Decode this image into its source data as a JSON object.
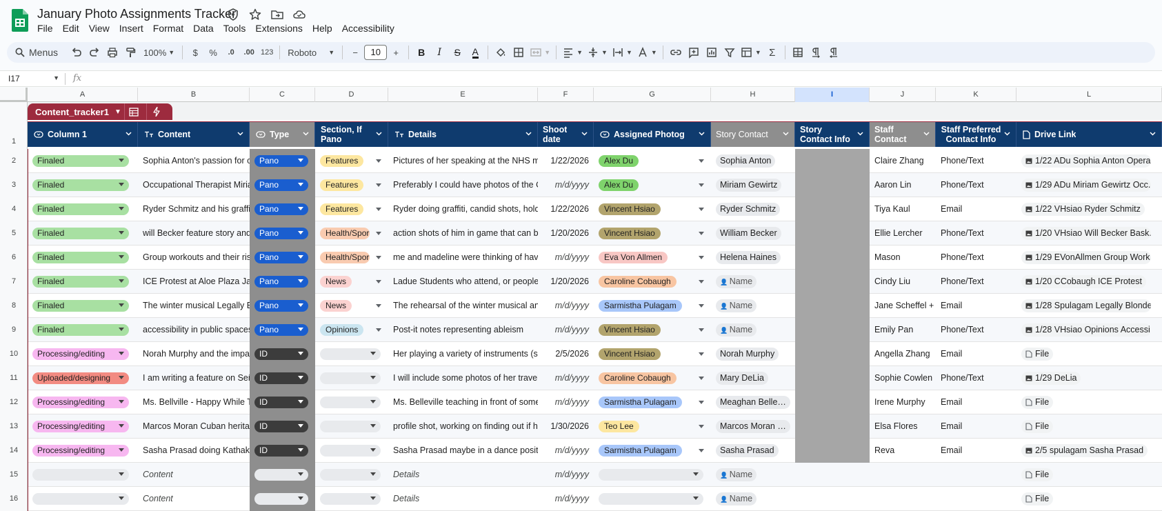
{
  "app": {
    "title": "January Photo Assignments Tracker",
    "menus": [
      "File",
      "Edit",
      "View",
      "Insert",
      "Format",
      "Data",
      "Tools",
      "Extensions",
      "Help",
      "Accessibility"
    ],
    "brand_color": "#0f9d58"
  },
  "toolbar": {
    "search_label": "Menus",
    "zoom": "100%",
    "currency": "$",
    "percent": "%",
    "decrease_decimal": ".0",
    "increase_decimal": ".00",
    "number_format": "123",
    "font": "Roboto",
    "font_size": "10",
    "minus": "−",
    "plus": "+",
    "bold": "B",
    "italic": "I",
    "strike": "S",
    "text_color": "A",
    "sum": "Σ"
  },
  "formula_bar": {
    "name_box": "I17",
    "fx": "fx",
    "value": ""
  },
  "columns": [
    "A",
    "B",
    "C",
    "D",
    "E",
    "F",
    "G",
    "H",
    "I",
    "J",
    "K",
    "L"
  ],
  "selected_column": "I",
  "row_numbers": [
    "1",
    "2",
    "3",
    "4",
    "5",
    "6",
    "7",
    "8",
    "9",
    "10",
    "11",
    "12",
    "13",
    "14",
    "15",
    "16"
  ],
  "table": {
    "name": "Content_tracker1",
    "header_color": "#0f3b6e",
    "tab_color": "#9d2b3e",
    "headers": {
      "a": "Column 1",
      "b": "Content",
      "c": "Type",
      "d1": "Section, If",
      "d2": "Pano",
      "e": "Details",
      "f1": "Shoot",
      "f2": "date",
      "g": "Assigned Photog",
      "h": "Story Contact",
      "i1": "Story",
      "i2": "Contact Info",
      "j1": "Staff",
      "j2": "Contact",
      "k1": "Staff Preferred",
      "k2": "Contact Info",
      "l": "Drive Link"
    },
    "status_colors": {
      "Finaled": "#a8e0a2",
      "Processing/editing": "#f7b7f0",
      "Uploaded/designing": "#f28b82"
    },
    "type_colors": {
      "Pano": "#1a5ecf",
      "ID": "#3c3c3c"
    },
    "section_colors": {
      "Features": "#fde7a0",
      "Health/Sport": "#f9cbb0",
      "News": "#fbd2d0",
      "Opinions": "#cbe5f0"
    },
    "photog_colors": {
      "Alex Du": "#7fd36c",
      "Vincent Hsiao": "#b2a46d",
      "Eva Von Allmen": "#f8c7c4",
      "Caroline Cobaugh": "#f8c5a2",
      "Sarmistha Pulagam": "#a8c7fa",
      "Teo Lee": "#fde7a0"
    },
    "rows": [
      {
        "status": "Finaled",
        "content": "Sophia Anton's passion for co",
        "type": "Pano",
        "section": "Features",
        "details": "Pictures of her speaking at the NHS me",
        "date": "1/22/2026",
        "photog": "Alex Du",
        "story_contact": "Sophia Anton",
        "staff": "Claire Zhang",
        "pref": "Phone/Text",
        "drive": "1/22 ADu Sophia Anton Opera..."
      },
      {
        "status": "Finaled",
        "content": "Occupational Therapist Miriam",
        "type": "Pano",
        "section": "Features",
        "details": "Preferably I could have photos of the OT",
        "date": "m/d/yyyy",
        "photog": "Alex Du",
        "story_contact": "Miriam Gewirtz",
        "staff": "Aaron Lin",
        "pref": "Phone/Text",
        "drive": "1/29 ADu Miriam Gewirtz Occ..."
      },
      {
        "status": "Finaled",
        "content": "Ryder Schmitz and his graffiti",
        "type": "Pano",
        "section": "Features",
        "details": "Ryder doing graffiti, candid shots, holdin",
        "date": "1/22/2026",
        "photog": "Vincent Hsiao",
        "story_contact": "Ryder Schmitz",
        "staff": "Tiya Kaul",
        "pref": "Email",
        "drive": "1/22 VHsiao Ryder Schmitz"
      },
      {
        "status": "Finaled",
        "content": "will Becker feature story and I",
        "type": "Pano",
        "section": "Health/Sport",
        "details": "action shots of him in game that can be",
        "date": "1/20/2026",
        "photog": "Vincent Hsiao",
        "story_contact": "William Becker",
        "staff": "Ellie Lercher",
        "pref": "Phone/Text",
        "drive": "1/20 VHsiao Will Becker Bask..."
      },
      {
        "status": "Finaled",
        "content": "Group workouts and their rise",
        "type": "Pano",
        "section": "Health/Sport",
        "details": "me and madeline were thinking of havin",
        "date": "m/d/yyyy",
        "photog": "Eva Von Allmen",
        "story_contact": "Helena Haines",
        "staff": "Mason",
        "pref": "Phone/Text",
        "drive": "1/29 EVonAllmen Group Work..."
      },
      {
        "status": "Finaled",
        "content": "ICE Protest at Aloe Plaza Jan",
        "type": "Pano",
        "section": "News",
        "details": "Ladue Students who attend, or people p",
        "date": "1/20/2026",
        "photog": "Caroline Cobaugh",
        "story_contact": "Name",
        "staff": "Cindy Liu",
        "pref": "Phone/Text",
        "drive": "1/20 CCobaugh ICE Protest"
      },
      {
        "status": "Finaled",
        "content": "The winter musical Legally Bl",
        "type": "Pano",
        "section": "News",
        "details": "The rehearsal of the winter musical and",
        "date": "m/d/yyyy",
        "photog": "Sarmistha Pulagam",
        "story_contact": "Name",
        "staff": "Jane Scheffel + I",
        "pref": "Email",
        "drive": "1/28 Spulagam Legally Blonde"
      },
      {
        "status": "Finaled",
        "content": "accessibility in public spaces",
        "type": "Pano",
        "section": "Opinions",
        "details": "Post-it notes representing ableism",
        "date": "m/d/yyyy",
        "photog": "Vincent Hsiao",
        "story_contact": "Name",
        "staff": "Emily Pan",
        "pref": "Phone/Text",
        "drive": "1/28 VHsiao Opinions Accessi..."
      },
      {
        "status": "Processing/editing",
        "content": "Norah Murphy and the impac",
        "type": "ID",
        "section": "",
        "details": "Her playing a variety of instruments (sh",
        "date": "2/5/2026",
        "photog": "Vincent Hsiao",
        "story_contact": "Norah Murphy",
        "staff": "Angella Zhang",
        "pref": "Email",
        "drive": "File"
      },
      {
        "status": "Uploaded/designing",
        "content": "I am writing a feature on Seño",
        "type": "ID",
        "section": "",
        "details": "I will include some photos of her travels",
        "date": "m/d/yyyy",
        "photog": "Caroline Cobaugh",
        "story_contact": "Mary DeLia",
        "staff": "Sophie Cowlen",
        "pref": "Phone/Text",
        "drive": "1/29 DeLia"
      },
      {
        "status": "Processing/editing",
        "content": "Ms. Bellville - Happy While Te",
        "type": "ID",
        "section": "",
        "details": "Ms. Belleville teaching in front of somet",
        "date": "m/d/yyyy",
        "photog": "Sarmistha Pulagam",
        "story_contact": "Meaghan Bellevi...",
        "staff": "Irene Murphy",
        "pref": "Email",
        "drive": "File"
      },
      {
        "status": "Processing/editing",
        "content": "Marcos Moran Cuban heritag",
        "type": "ID",
        "section": "",
        "details": "profile shot, working on finding out if he",
        "date": "1/30/2026",
        "photog": "Teo Lee",
        "story_contact": "Marcos Moran E...",
        "staff": "Elsa Flores",
        "pref": "Email",
        "drive": "File"
      },
      {
        "status": "Processing/editing",
        "content": "Sasha Prasad doing Kathak a",
        "type": "ID",
        "section": "",
        "details": "Sasha Prasad maybe in a dance positio",
        "date": "m/d/yyyy",
        "photog": "Sarmistha Pulagam",
        "story_contact": "Sasha Prasad",
        "staff": "Reva",
        "pref": "Email",
        "drive": "2/5 spulagam Sasha Prasad"
      },
      {
        "status": "",
        "content": "Content",
        "type": "",
        "section": "",
        "details": "Details",
        "date": "m/d/yyyy",
        "photog": "",
        "story_contact": "Name",
        "staff": "",
        "pref": "",
        "drive": "File"
      },
      {
        "status": "",
        "content": "Content",
        "type": "",
        "section": "",
        "details": "Details",
        "date": "m/d/yyyy",
        "photog": "",
        "story_contact": "Name",
        "staff": "",
        "pref": "",
        "drive": "File"
      }
    ]
  }
}
